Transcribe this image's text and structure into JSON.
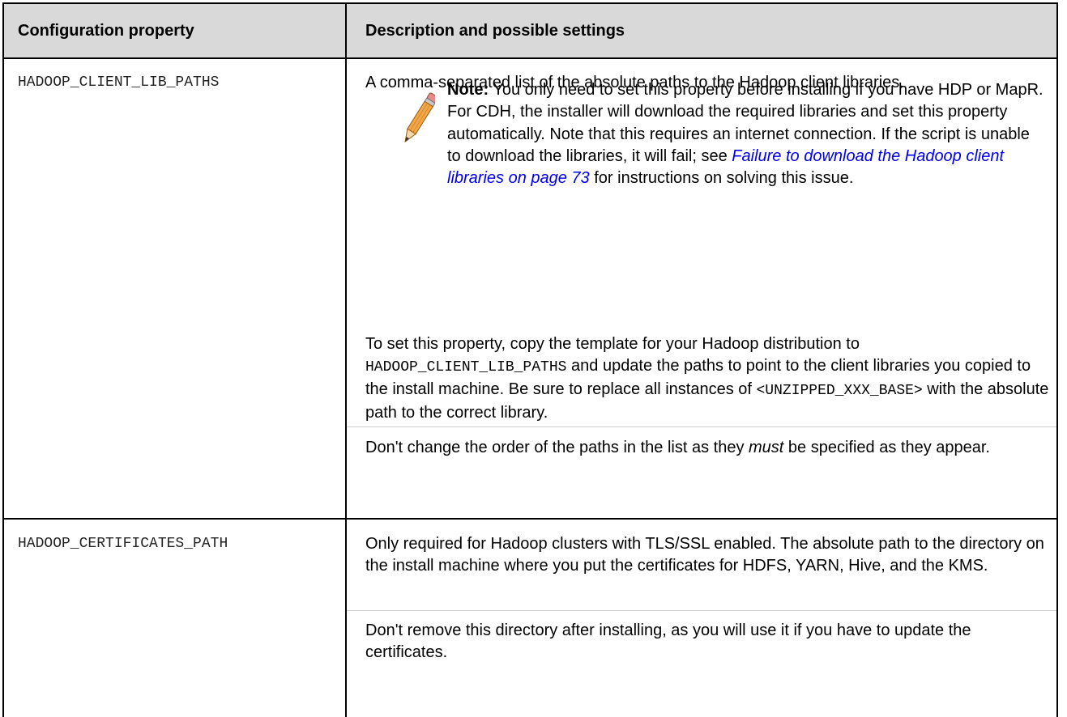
{
  "headers": {
    "property": "Configuration property",
    "description": "Description and possible settings"
  },
  "rows": [
    {
      "property": "HADOOP_CLIENT_LIB_PATHS",
      "intro": "A comma-separated list of the absolute paths to the Hadoop client libraries.",
      "note_label": "Note:",
      "note_text_1": "You only need to set this property before installing if you have HDP or MapR. For CDH, the installer will download the required libraries and set this property automatically. Note that this requires an internet connection. If the script is unable to download the libraries, it will fail; see ",
      "note_link": "Failure to download the Hadoop client libraries on page 73",
      "note_text_2": " for instructions on solving this issue.",
      "para2_a": "To set this property, copy the template for your Hadoop distribution to",
      "para2_code1": "HADOOP_CLIENT_LIB_PATHS",
      "para2_b": "and update the paths to point to the client libraries you copied to the install machine. Be sure to replace all instances of",
      "para2_code2": "<UNZIPPED_XXX_BASE>",
      "para2_c": "with the absolute path to the correct library.",
      "para3_a": "Don't change the order of the paths in the list as they",
      "para3_em": "must",
      "para3_b": "be specified as they appear."
    },
    {
      "property": "HADOOP_CERTIFICATES_PATH",
      "para1": "Only required for Hadoop clusters with TLS/SSL enabled. The absolute path to the directory on the install machine where you put the certificates for HDFS, YARN, Hive, and the KMS.",
      "para2": "Don't remove this directory after installing, as you will use it if you have to update the certificates."
    }
  ]
}
